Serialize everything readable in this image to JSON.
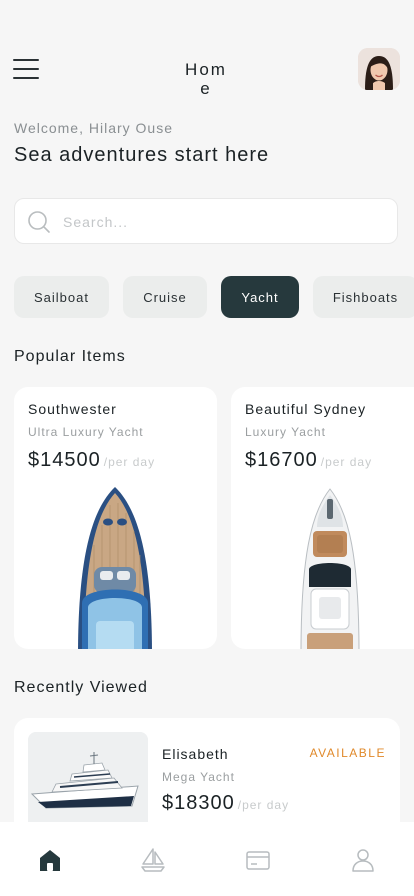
{
  "header": {
    "title": "Home",
    "menu_icon": "hamburger-menu-icon",
    "avatar_icon": "user-avatar"
  },
  "welcome": "Welcome, Hilary Ouse",
  "headline": "Sea adventures start here",
  "search": {
    "placeholder": "Search...",
    "value": "",
    "icon": "search-icon"
  },
  "categories": [
    {
      "label": "Sailboat",
      "active": false
    },
    {
      "label": "Cruise",
      "active": false
    },
    {
      "label": "Yacht",
      "active": true
    },
    {
      "label": "Fishboats",
      "active": false
    }
  ],
  "popular": {
    "title": "Popular Items",
    "items": [
      {
        "name": "Southwester",
        "type": "Ultra Luxury Yacht",
        "price": "$14500",
        "unit": "/per day"
      },
      {
        "name": "Beautiful Sydney",
        "type": "Luxury Yacht",
        "price": "$16700",
        "unit": "/per day"
      }
    ]
  },
  "recent": {
    "title": "Recently Viewed",
    "items": [
      {
        "name": "Elisabeth",
        "type": "Mega Yacht",
        "price": "$18300",
        "unit": "/per day",
        "status": "AVAILABLE"
      }
    ]
  },
  "nav": [
    {
      "icon": "home-icon",
      "active": true
    },
    {
      "icon": "sailboat-icon",
      "active": false
    },
    {
      "icon": "card-icon",
      "active": false
    },
    {
      "icon": "profile-icon",
      "active": false
    }
  ],
  "colors": {
    "accent": "#26393d",
    "background": "#f6f6f6",
    "status_available": "#e0892a"
  }
}
